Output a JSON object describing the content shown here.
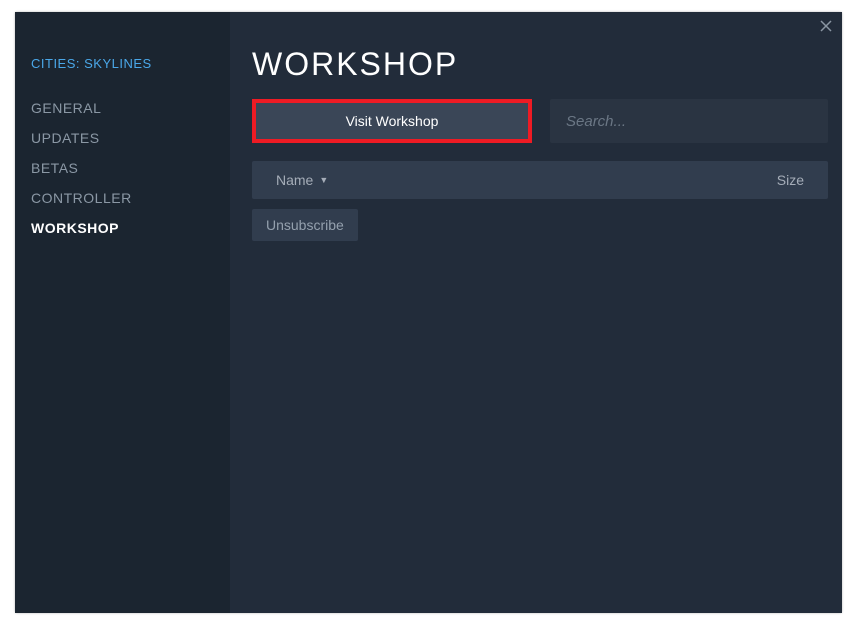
{
  "sidebar": {
    "game_title": "CITIES: SKYLINES",
    "items": [
      {
        "label": "GENERAL",
        "active": false
      },
      {
        "label": "UPDATES",
        "active": false
      },
      {
        "label": "BETAS",
        "active": false
      },
      {
        "label": "CONTROLLER",
        "active": false
      },
      {
        "label": "WORKSHOP",
        "active": true
      }
    ]
  },
  "main": {
    "page_title": "WORKSHOP",
    "visit_button": "Visit Workshop",
    "search_placeholder": "Search...",
    "table": {
      "col_name": "Name",
      "col_size": "Size",
      "sort_indicator": "▼"
    },
    "unsubscribe_button": "Unsubscribe"
  }
}
